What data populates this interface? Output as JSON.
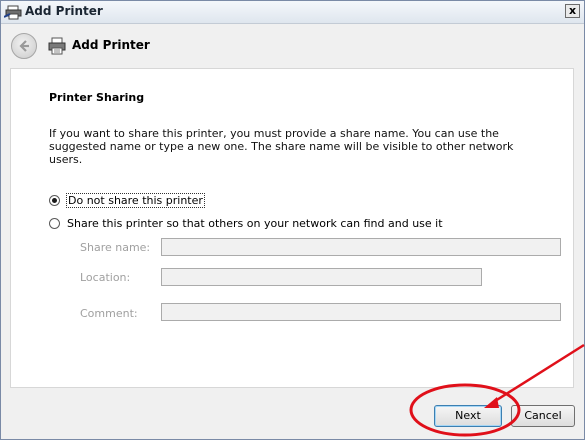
{
  "window": {
    "title": "Add Printer",
    "close_label": "x"
  },
  "header": {
    "title": "Add Printer"
  },
  "content": {
    "section_title": "Printer Sharing",
    "description": "If you want to share this printer, you must provide a share name. You can use the suggested name or type a new one. The share name will be visible to other network users.",
    "options": [
      {
        "label": "Do not share this printer",
        "selected": true
      },
      {
        "label": "Share this printer so that others on your network can find and use it",
        "selected": false
      }
    ],
    "fields": [
      {
        "label": "Share name:",
        "value": ""
      },
      {
        "label": "Location:",
        "value": ""
      },
      {
        "label": "Comment:",
        "value": ""
      }
    ]
  },
  "buttons": {
    "next": "Next",
    "cancel": "Cancel"
  },
  "colors": {
    "annotation": "#e0101a",
    "default_button_border": "#3c7fb1"
  }
}
